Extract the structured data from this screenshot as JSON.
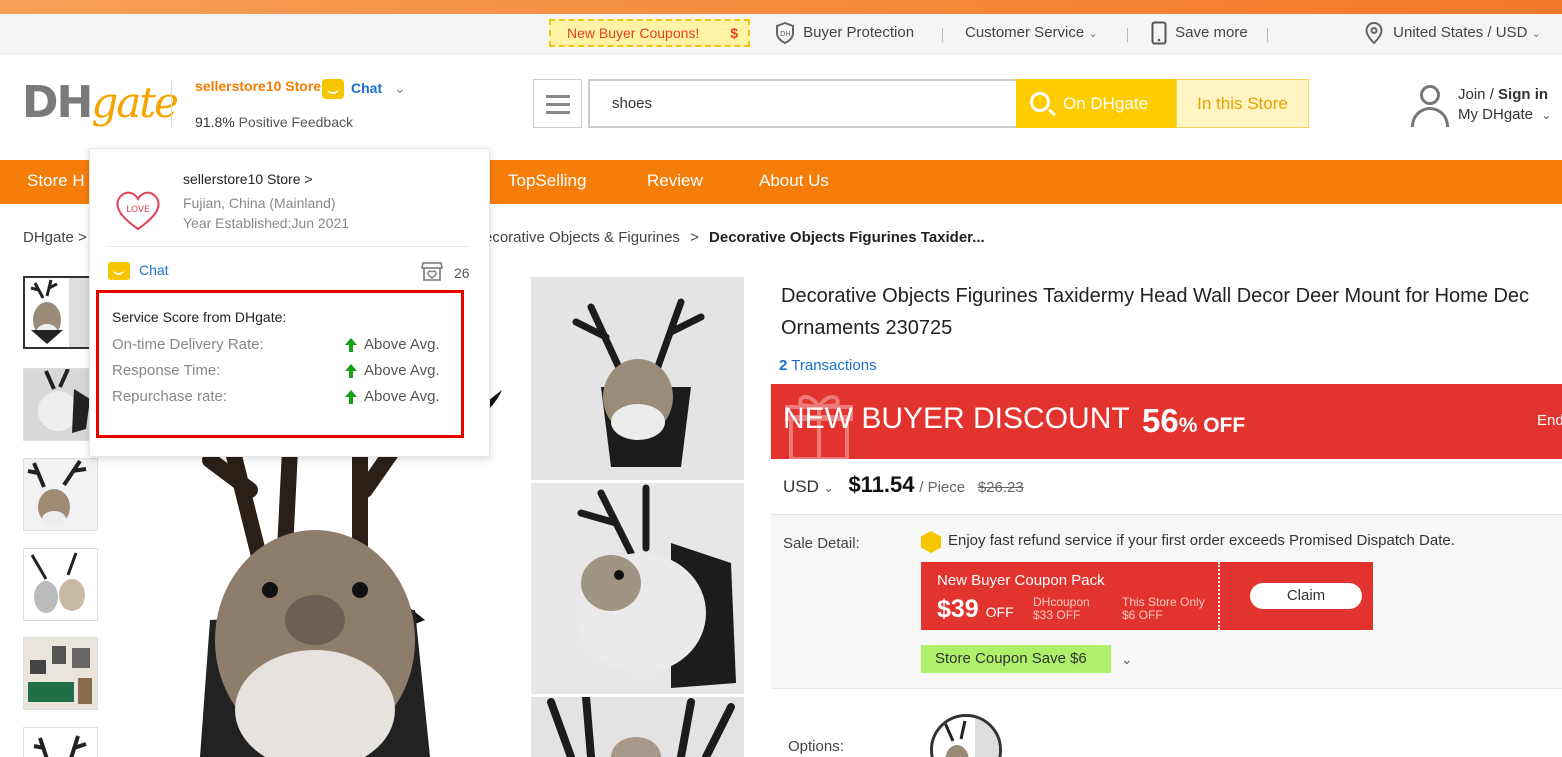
{
  "utility_bar": {
    "coupon_label": "New Buyer Coupons!",
    "coupon_symbol": "$",
    "buyer_protection": "Buyer Protection",
    "customer_service": "Customer Service",
    "save_more": "Save more",
    "region": "United States / USD"
  },
  "header": {
    "logo_dh": "DH",
    "logo_gate": "gate",
    "store_name": "sellerstore10 Store",
    "chat_label": "Chat",
    "feedback_pct": "91.8%",
    "feedback_label": "Positive Feedback",
    "search_value": "shoes",
    "btn_on_dhgate": "On DHgate",
    "btn_in_store": "In this Store",
    "join": "Join",
    "sign_in": "Sign in",
    "my_dhgate": "My DHgate"
  },
  "nav": {
    "items": [
      "Store H",
      "TopSelling",
      "Review",
      "About Us"
    ]
  },
  "breadcrumb": {
    "root": "DHgate",
    "sep": ">",
    "parent": "ecorative Objects & Figurines",
    "current": "Decorative Objects Figurines Taxider..."
  },
  "store_popup": {
    "logo_text": "LOVE",
    "name": "sellerstore10 Store >",
    "location": "Fujian, China (Mainland)",
    "year": "Year Established:Jun 2021",
    "chat": "Chat",
    "store_count": "26",
    "score_title": "Service Score from DHgate:",
    "scores": [
      {
        "label": "On-time Delivery Rate:",
        "value": "Above Avg."
      },
      {
        "label": "Response Time:",
        "value": "Above Avg."
      },
      {
        "label": "Repurchase rate:",
        "value": "Above Avg."
      }
    ]
  },
  "product": {
    "title": "Decorative Objects Figurines Taxidermy Head Wall Decor Deer Mount for Home Dec Ornaments 230725",
    "transactions_count": "2",
    "transactions_label": "Transactions",
    "discount_label": "NEW BUYER DISCOUNT",
    "discount_pct": "56",
    "discount_off": "% OFF",
    "discount_ends": "End",
    "currency": "USD",
    "price": "$11.54",
    "per": "/ Piece",
    "old_price": "$26.23",
    "sale_detail_label": "Sale Detail:",
    "refund_text": "Enjoy fast refund service if your first order exceeds Promised Dispatch Date.",
    "coupon_title": "New Buyer Coupon Pack",
    "coupon_amount": "$39",
    "coupon_off": "OFF",
    "coupon_sub1_a": "DHcoupon",
    "coupon_sub1_b": "$33 OFF",
    "coupon_sub2_a": "This Store Only",
    "coupon_sub2_b": "$6 OFF",
    "claim": "Claim",
    "store_coupon": "Store Coupon Save $6",
    "options_label": "Options:"
  },
  "colors": {
    "brand_orange": "#f57e0a",
    "search_yellow": "#ffcc00",
    "discount_red": "#e2332f",
    "link_blue": "#1a6fd1",
    "highlight_red": "#ee0000",
    "coupon_green": "#aef06a"
  }
}
